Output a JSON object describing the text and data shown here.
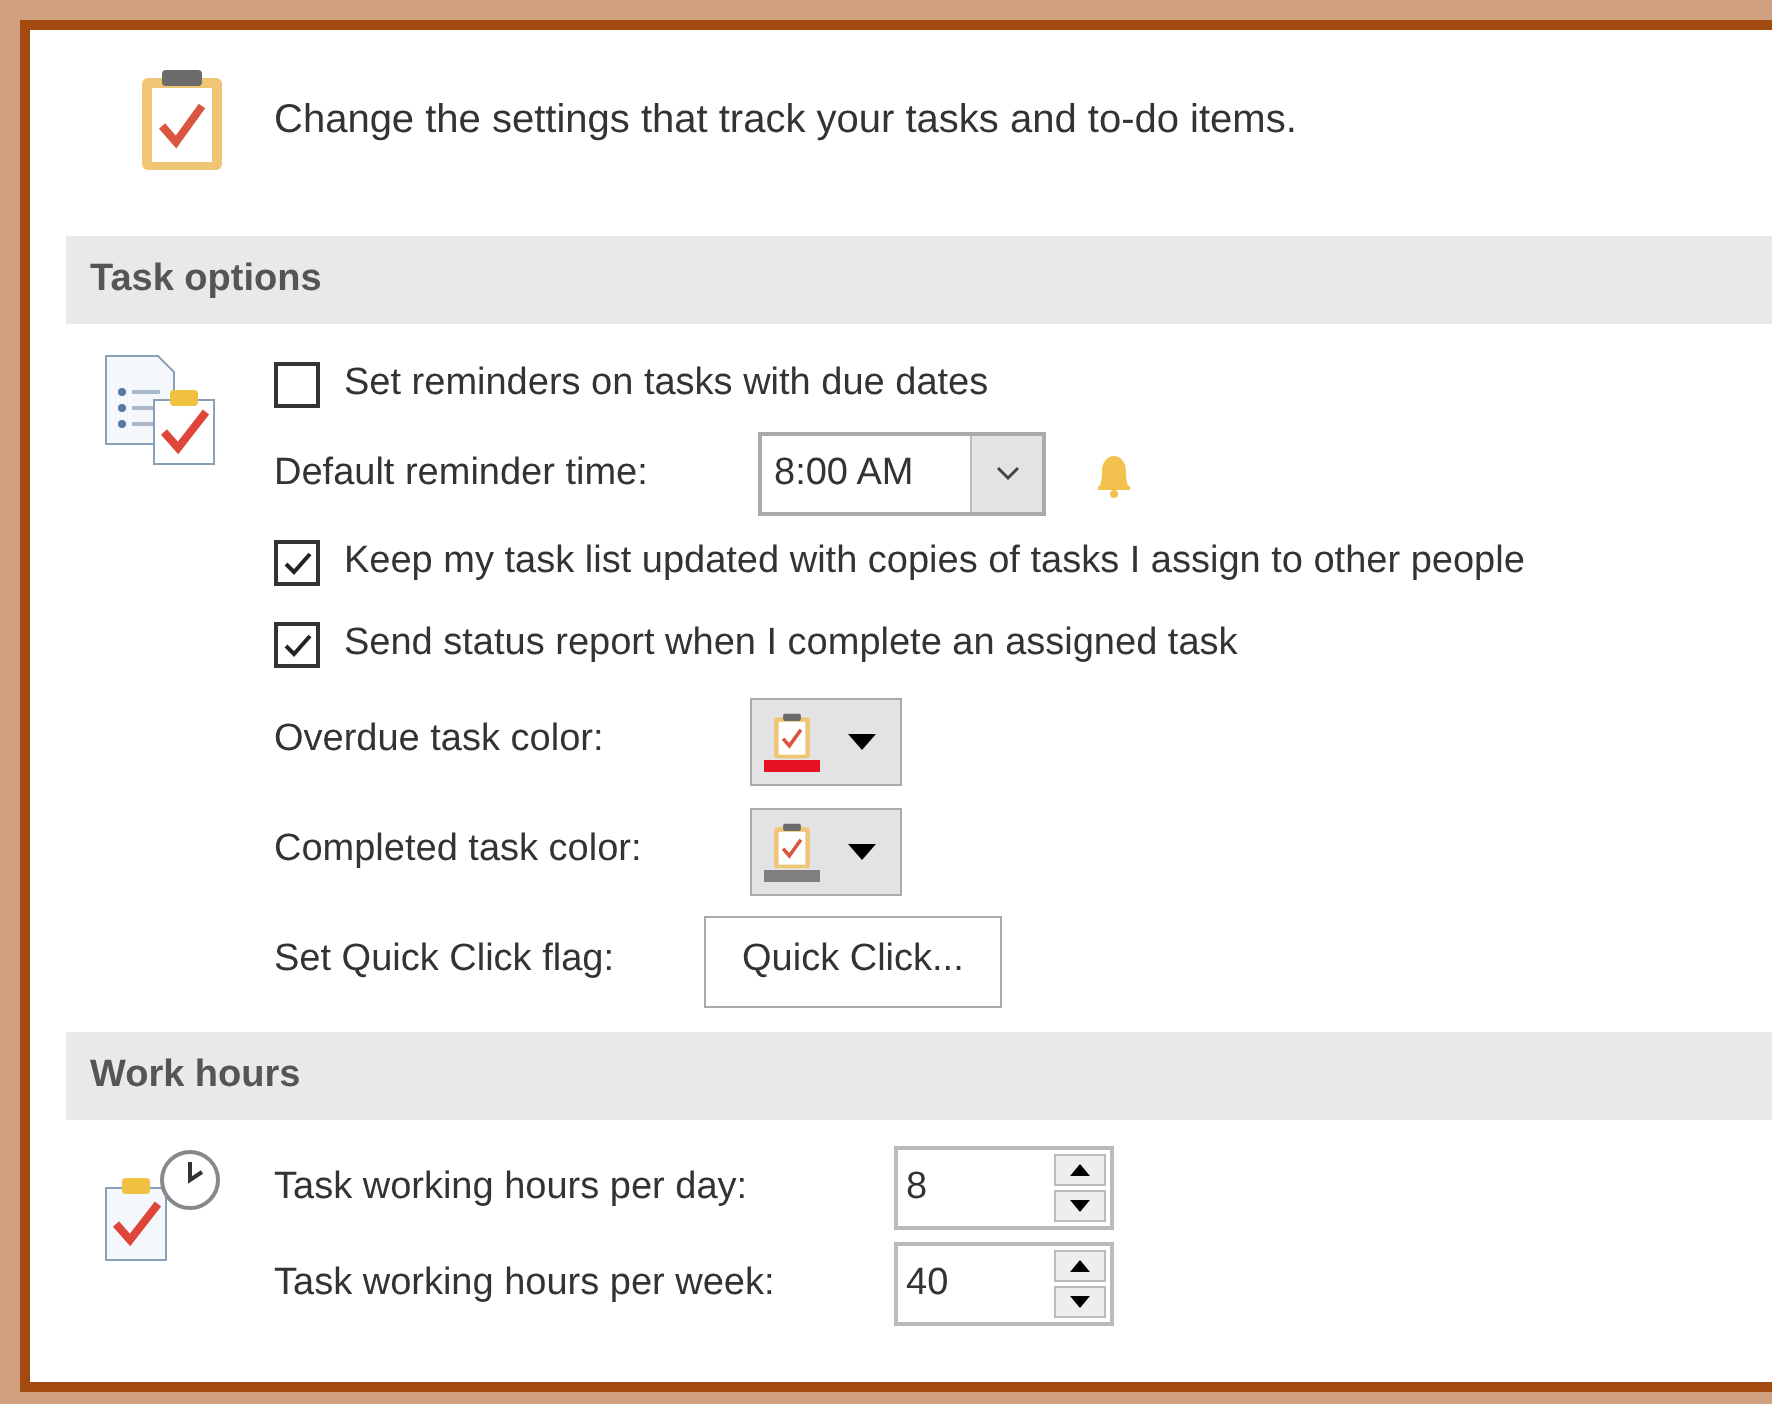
{
  "header": {
    "text": "Change the settings that track your tasks and to-do items."
  },
  "sections": [
    {
      "title": "Task options",
      "rows": [
        {
          "kind": "checkbox",
          "label": "Set reminders on tasks with due dates",
          "checked": false
        },
        {
          "kind": "dropdown",
          "label": "Default reminder time:",
          "value": "8:00 AM"
        },
        {
          "kind": "checkbox",
          "label": "Keep my task list updated with copies of tasks I assign to other people",
          "checked": true
        },
        {
          "kind": "checkbox",
          "label": "Send status report when I complete an assigned task",
          "checked": true
        },
        {
          "kind": "color",
          "label": "Overdue task color:",
          "color": "#e81123"
        },
        {
          "kind": "color",
          "label": "Completed task color:",
          "color": "#7f7f7f"
        },
        {
          "kind": "button",
          "label": "Set Quick Click flag:",
          "button": "Quick Click..."
        }
      ]
    },
    {
      "title": "Work hours",
      "rows": [
        {
          "kind": "spinner",
          "label": "Task working hours per day:",
          "value": "8"
        },
        {
          "kind": "spinner",
          "label": "Task working hours per week:",
          "value": "40"
        }
      ]
    }
  ]
}
